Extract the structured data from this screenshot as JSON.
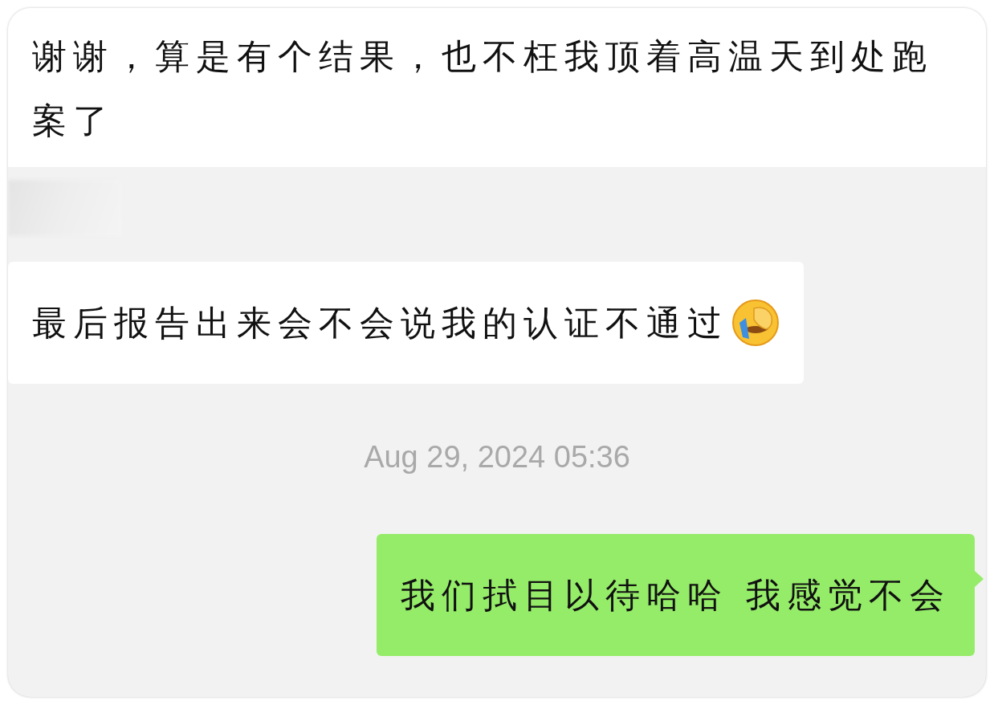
{
  "messages": [
    {
      "kind": "incoming",
      "lines": [
        "谢谢，算是有个结果，也不枉我顶着高温天到处跑",
        "案了"
      ],
      "emoji": false
    },
    {
      "kind": "sender"
    },
    {
      "kind": "incoming",
      "lines": [
        "最后报告出来会不会说我的认证不通过"
      ],
      "emoji": true
    },
    {
      "kind": "timestamp",
      "text": "Aug 29, 2024 05:36"
    },
    {
      "kind": "outgoing",
      "lines": [
        "我们拭目以待哈哈 我感觉不会"
      ],
      "emoji": false
    }
  ]
}
